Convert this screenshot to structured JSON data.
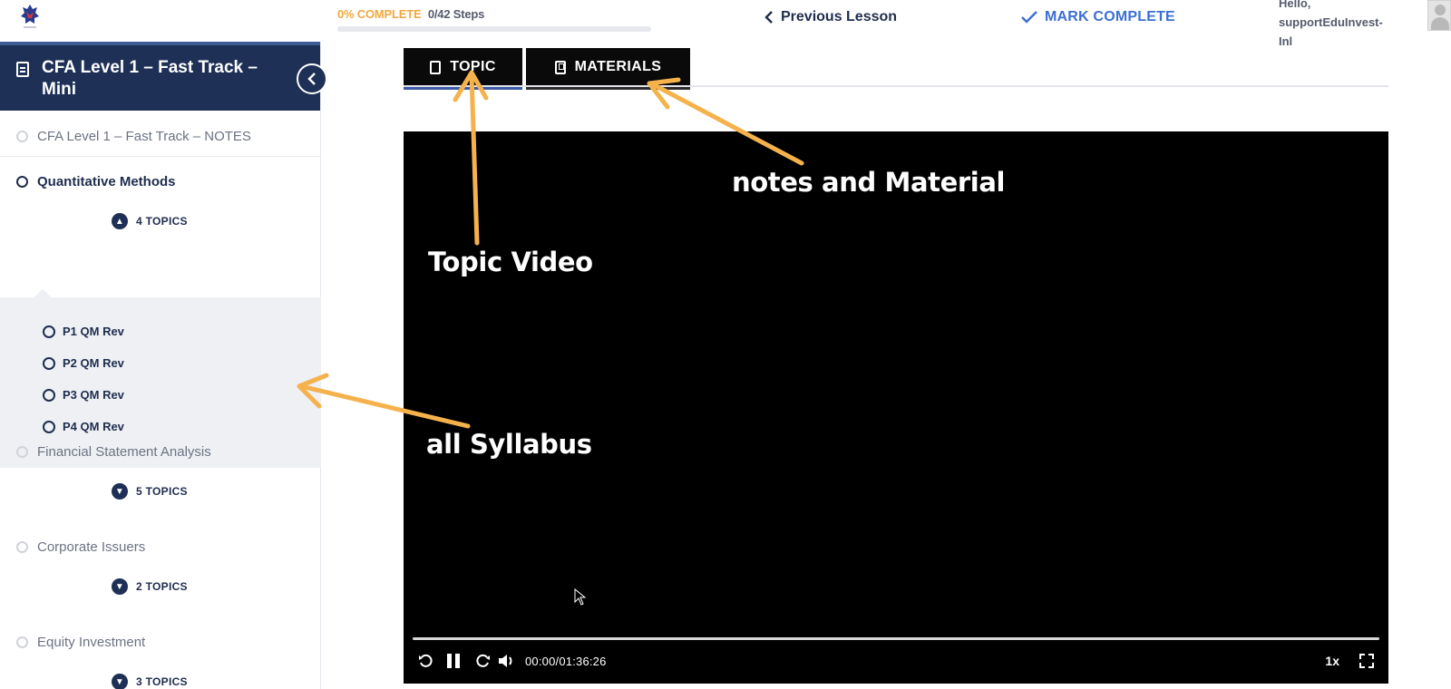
{
  "header": {
    "progress_percent_label": "0% COMPLETE",
    "progress_steps": "0/42 Steps",
    "progress_value": 0,
    "previous_lesson": "Previous Lesson",
    "mark_complete": "MARK COMPLETE",
    "user_greeting_lines": [
      "Hello,",
      "supportEduInvest-",
      "Inl"
    ]
  },
  "sidebar": {
    "course_title": "CFA Level 1 – Fast Track – Mini",
    "collapse_icon": "chevron-left-icon",
    "lessons": [
      {
        "label": "CFA Level 1 – Fast Track – NOTES"
      },
      {
        "label": "Quantitative Methods",
        "topics_label": "4 TOPICS",
        "expanded": true,
        "topics": [
          "P1 QM Rev",
          "P2 QM Rev",
          "P3 QM Rev",
          "P4 QM Rev"
        ]
      },
      {
        "label": "Financial Statement Analysis",
        "topics_label": "5 TOPICS"
      },
      {
        "label": "Corporate Issuers",
        "topics_label": "2 TOPICS"
      },
      {
        "label": "Equity Investment",
        "topics_label": "3 TOPICS"
      }
    ]
  },
  "tabs": [
    {
      "label": "TOPIC",
      "icon": "document-icon",
      "active": true
    },
    {
      "label": "MATERIALS",
      "icon": "bookmark-icon",
      "active": false
    }
  ],
  "video": {
    "timecode": "00:00/01:36:26",
    "speed": "1x",
    "played_fraction": 0
  },
  "annotations": {
    "notes": "notes and Material",
    "topic_video": "Topic Video",
    "syllabus": "all Syllabus",
    "arrow_color": "#f5b24c"
  },
  "colors": {
    "accent_orange": "#f0a940",
    "navy": "#1e3056",
    "link_blue": "#3b6fd1"
  }
}
